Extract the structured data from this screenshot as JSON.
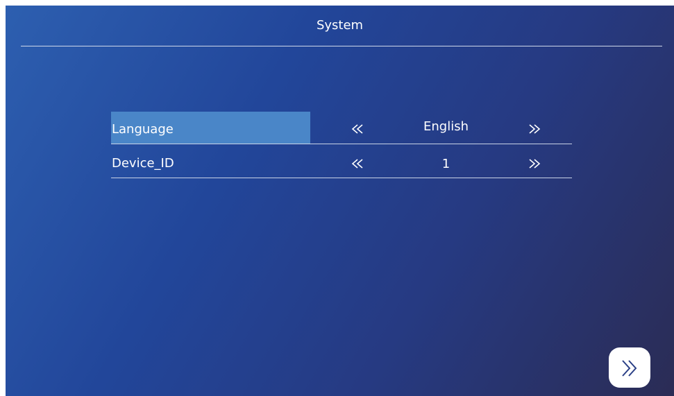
{
  "header": {
    "title": "System"
  },
  "settings": {
    "rows": [
      {
        "label": "Language",
        "value": "English",
        "selected": true
      },
      {
        "label": "Device_ID",
        "value": "1",
        "selected": false
      }
    ]
  },
  "icons": {
    "prev": "double-chevron-left-icon",
    "next": "double-chevron-right-icon",
    "next_page": "double-chevron-right-icon"
  },
  "colors": {
    "background_start": "#2d5fb0",
    "background_end": "#2b2c55",
    "selected_row": "#4a86c8",
    "text": "#ffffff"
  }
}
